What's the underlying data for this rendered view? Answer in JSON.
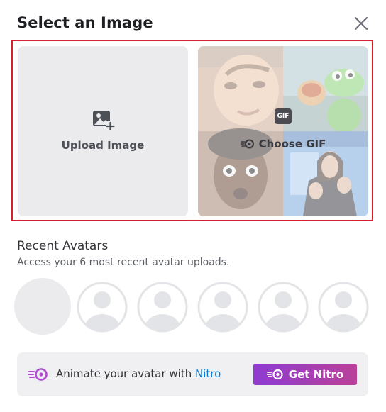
{
  "modal": {
    "title": "Select an Image",
    "close_icon": "close-icon"
  },
  "options": {
    "upload": {
      "label": "Upload Image",
      "icon": "image-plus-icon"
    },
    "gif": {
      "label": "Choose GIF",
      "badge": "GIF",
      "icon": "nitro-gif-icon"
    }
  },
  "recent": {
    "title": "Recent Avatars",
    "subtitle": "Access your 6 most recent avatar uploads.",
    "slots": [
      "empty",
      "placeholder",
      "placeholder",
      "placeholder",
      "placeholder",
      "placeholder"
    ]
  },
  "nitro": {
    "text_prefix": "Animate your avatar with ",
    "link_label": "Nitro",
    "button_label": "Get Nitro",
    "icon": "nitro-icon"
  },
  "colors": {
    "highlight_border": "#d81e2a",
    "nitro_gradient_start": "#8f3bd1",
    "nitro_gradient_end": "#b9409a",
    "link": "#0b7bd6"
  }
}
